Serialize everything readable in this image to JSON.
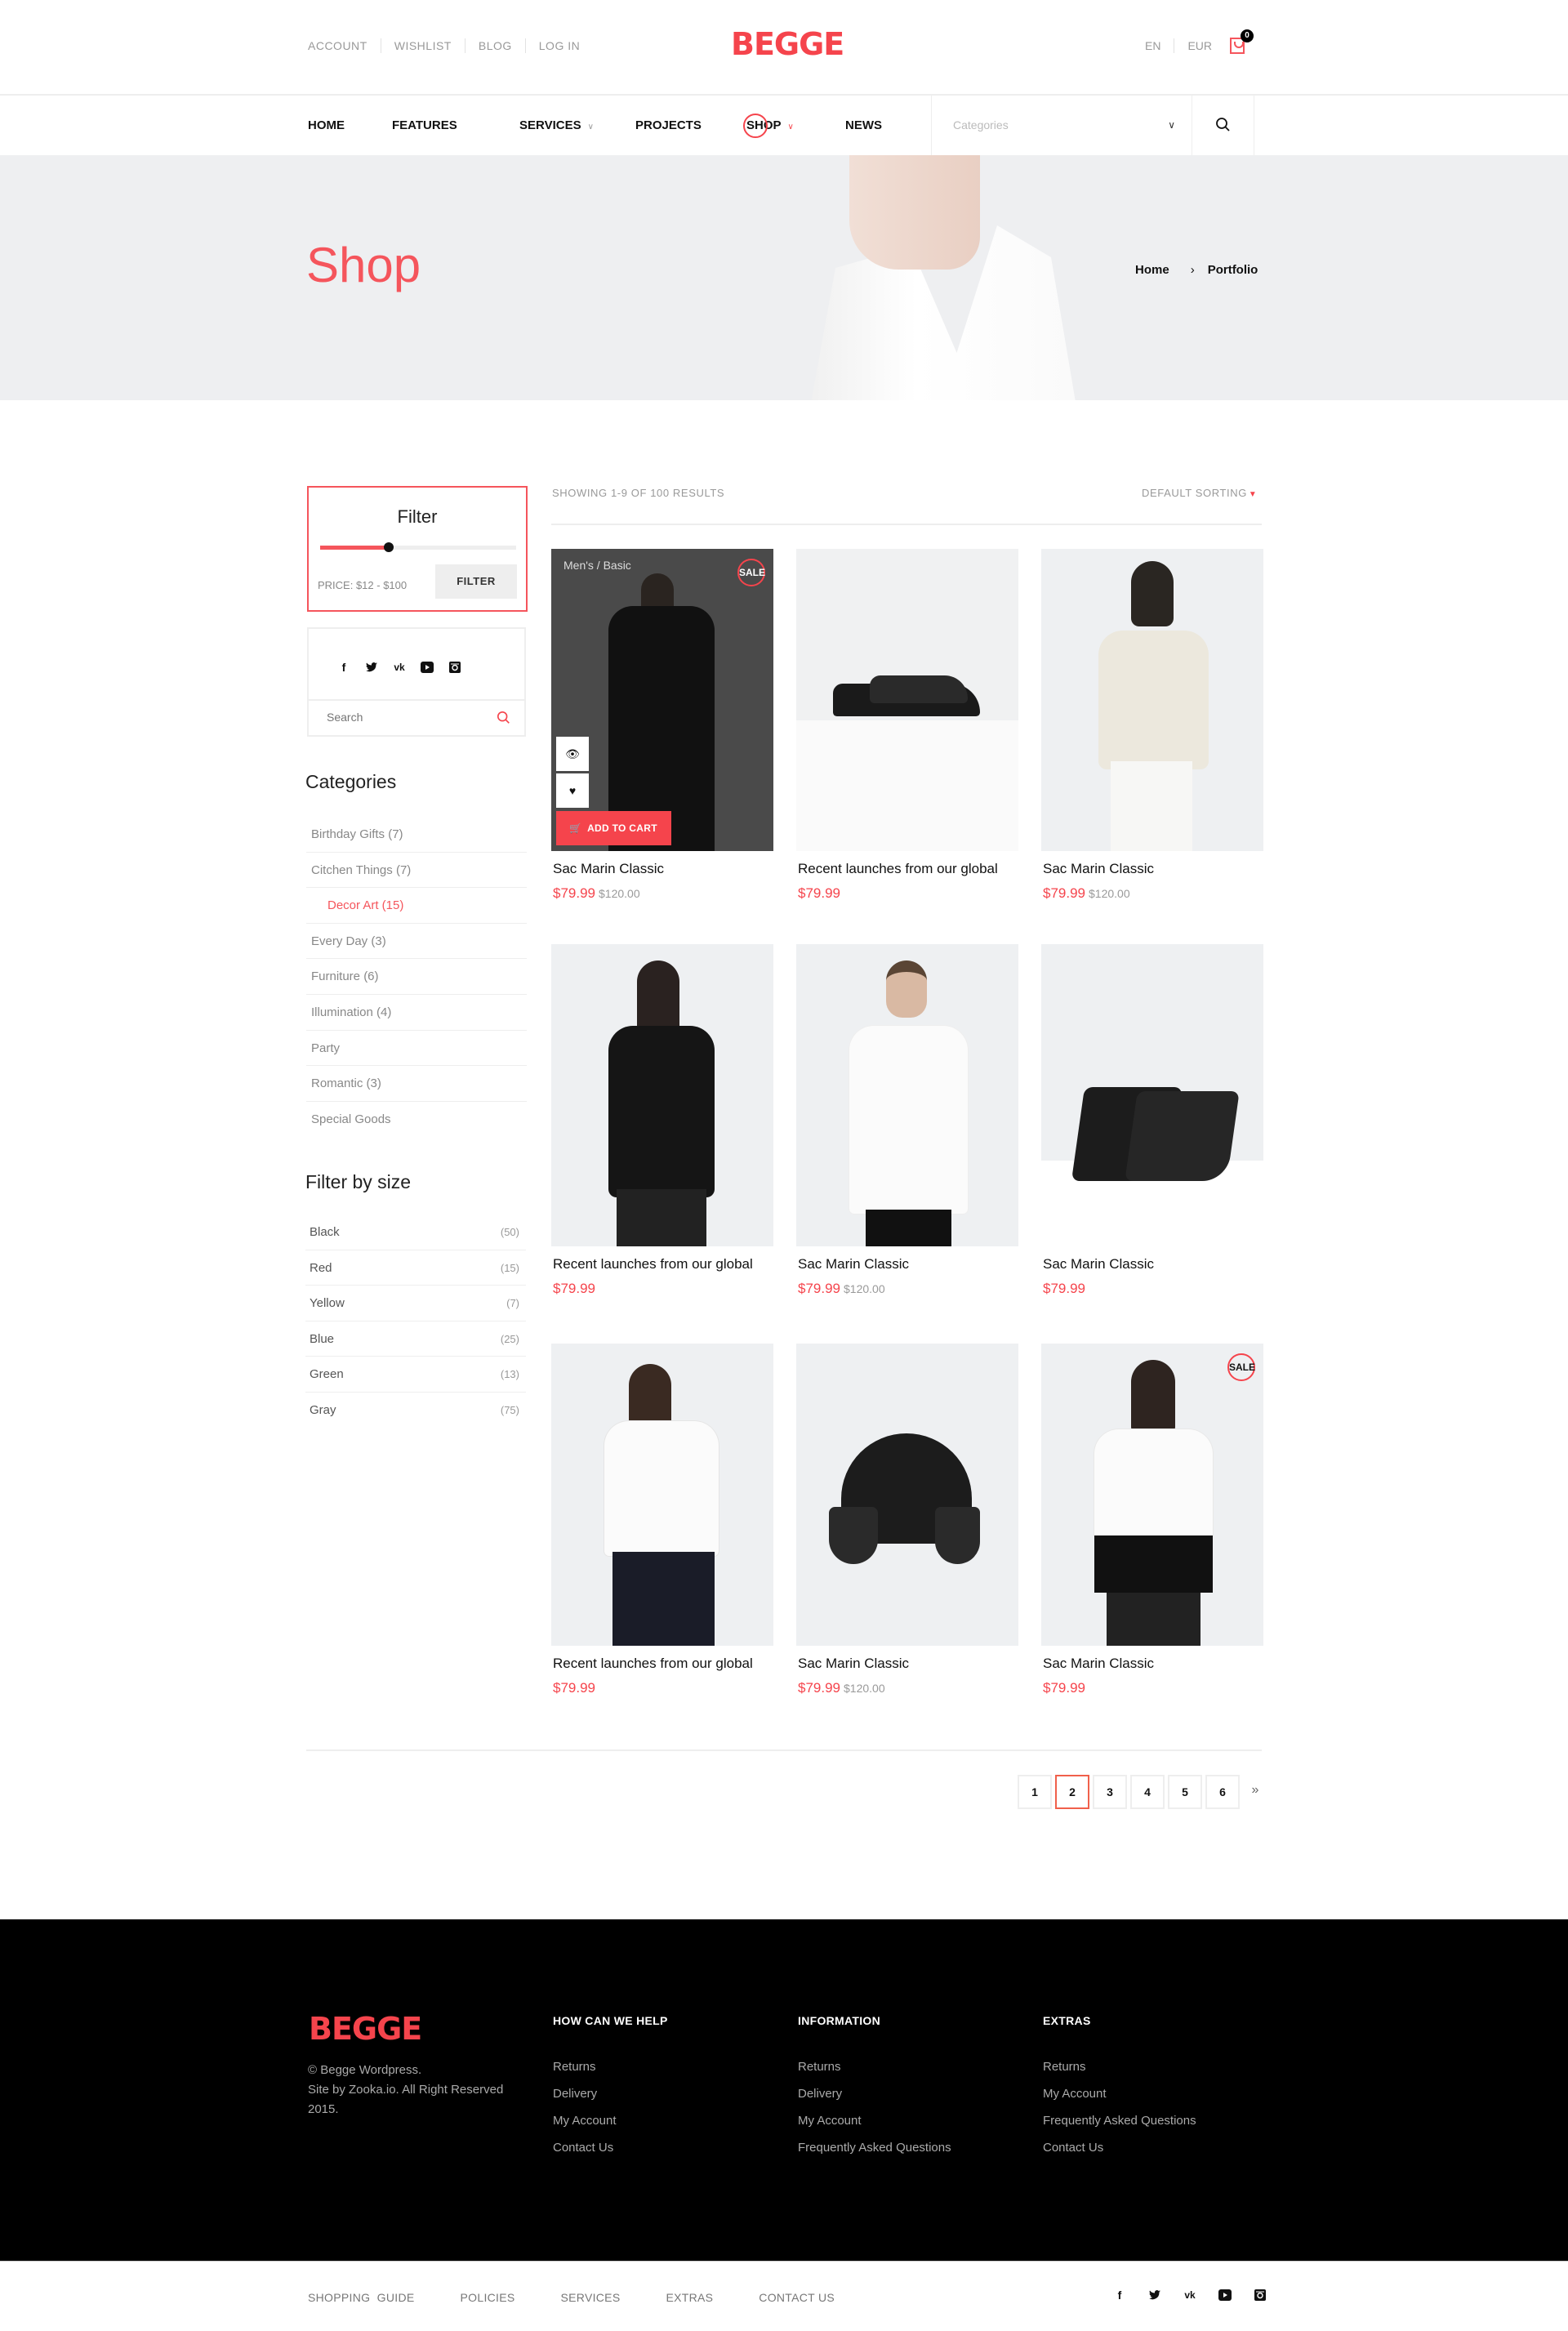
{
  "topbar": {
    "links": [
      "ACCOUNT",
      "WISHLIST",
      "BLOG",
      "LOG IN"
    ],
    "logo": "BEGGE",
    "language": "EN",
    "currency": "EUR",
    "cart_count": "0"
  },
  "nav": {
    "items": [
      {
        "label": "HOME",
        "has_dropdown": false
      },
      {
        "label": "FEATURES",
        "has_dropdown": false
      },
      {
        "label": "SERVICES",
        "has_dropdown": true
      },
      {
        "label": "PROJECTS",
        "has_dropdown": false
      },
      {
        "label": "SHOP",
        "has_dropdown": true,
        "active": true
      },
      {
        "label": "NEWS",
        "has_dropdown": false
      }
    ],
    "category_select": {
      "placeholder": "Categories"
    },
    "search_icon": "search-icon"
  },
  "hero": {
    "title": "Shop",
    "breadcrumb": [
      "Home",
      "Portfolio"
    ]
  },
  "sidebar": {
    "filter": {
      "title": "Filter",
      "price_label": "PRICE: $12 - $100",
      "button": "FILTER",
      "slider_fraction": 0.35
    },
    "social_icons": [
      "facebook-icon",
      "twitter-icon",
      "vk-icon",
      "youtube-icon",
      "instagram-icon"
    ],
    "search": {
      "placeholder": "Search"
    },
    "categories_title": "Categories",
    "categories": [
      {
        "label": "Birthday Gifts (7)"
      },
      {
        "label": "Citchen Things (7)"
      },
      {
        "label": "Decor Art (15)",
        "active": true
      },
      {
        "label": "Every Day (3)"
      },
      {
        "label": "Furniture (6)"
      },
      {
        "label": "Illumination (4)"
      },
      {
        "label": "Party"
      },
      {
        "label": "Romantic (3)"
      },
      {
        "label": "Special Goods"
      }
    ],
    "size_title": "Filter by size",
    "sizes": [
      {
        "label": "Black",
        "count": "(50)"
      },
      {
        "label": "Red",
        "count": "(15)"
      },
      {
        "label": "Yellow",
        "count": "(7)"
      },
      {
        "label": "Blue",
        "count": "(25)"
      },
      {
        "label": "Green",
        "count": "(13)"
      },
      {
        "label": "Gray",
        "count": "(75)"
      }
    ]
  },
  "results": {
    "summary": "SHOWING 1-9 OF 100 RESULTS",
    "sorting": "DEFAULT SORTING"
  },
  "products": [
    {
      "title": "Sac Marin Classic",
      "price": "$79.99",
      "old_price": "$120.00",
      "sale": "SALE",
      "hover": true,
      "category_label": "Men's / Basic",
      "add_to_cart": "ADD TO CART",
      "image": "man-black-coat"
    },
    {
      "title": "Recent launches from our global",
      "price": "$79.99",
      "old_price": "",
      "image": "black-loafers"
    },
    {
      "title": "Sac Marin Classic",
      "price": "$79.99",
      "old_price": "$120.00",
      "image": "woman-cream-sweater"
    },
    {
      "title": "Recent launches from our global",
      "price": "$79.99",
      "old_price": "",
      "image": "woman-black-blouse"
    },
    {
      "title": "Sac Marin Classic",
      "price": "$79.99",
      "old_price": "$120.00",
      "image": "man-white-tee"
    },
    {
      "title": "Sac Marin Classic",
      "price": "$79.99",
      "old_price": "",
      "image": "black-high-top-sneakers"
    },
    {
      "title": "Recent launches from our global",
      "price": "$79.99",
      "old_price": "",
      "image": "woman-white-shirt"
    },
    {
      "title": "Sac Marin Classic",
      "price": "$79.99",
      "old_price": "$120.00",
      "image": "black-trapper-hat"
    },
    {
      "title": "Sac Marin Classic",
      "price": "$79.99",
      "old_price": "",
      "sale": "SALE",
      "image": "woman-black-white-top"
    }
  ],
  "pagination": {
    "pages": [
      "1",
      "2",
      "3",
      "4",
      "5",
      "6"
    ],
    "current": "2",
    "next": "»"
  },
  "footer": {
    "logo": "BEGGE",
    "copyright": [
      "© Begge Wordpress.",
      "Site by Zooka.io. All Right Reserved 2015."
    ],
    "columns": [
      {
        "title": "HOW CAN WE HELP",
        "links": [
          "Returns",
          "Delivery",
          "My Account",
          "Contact Us"
        ]
      },
      {
        "title": "INFORMATION",
        "links": [
          "Returns",
          "Delivery",
          "My Account",
          "Frequently Asked Questions"
        ]
      },
      {
        "title": "EXTRAS",
        "links": [
          "Returns",
          "My Account",
          "Frequently Asked Questions",
          "Contact Us"
        ]
      }
    ],
    "bottom_links": [
      "SHOPPING  GUIDE",
      "POLICIES",
      "SERVICES",
      "EXTRAS",
      "CONTACT US"
    ],
    "social_icons": [
      "facebook-icon",
      "twitter-icon",
      "vk-icon",
      "youtube-icon",
      "instagram-icon"
    ]
  },
  "colors": {
    "accent": "#f5444c",
    "footer_bg": "#000000",
    "hero_bg": "#eeeff1"
  }
}
